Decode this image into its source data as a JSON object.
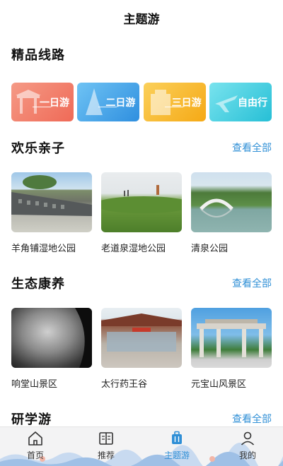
{
  "header": {
    "title": "主题游"
  },
  "featured": {
    "heading": "精品线路",
    "routes": [
      {
        "label": "一日游",
        "color": "#f27562"
      },
      {
        "label": "二日游",
        "color": "#3ea2e8"
      },
      {
        "label": "三日游",
        "color": "#f7b825"
      },
      {
        "label": "自由行",
        "color": "#3fd0e2"
      }
    ]
  },
  "family": {
    "heading": "欢乐亲子",
    "more": "查看全部",
    "items": [
      {
        "name": "羊角铺湿地公园"
      },
      {
        "name": "老道泉湿地公园"
      },
      {
        "name": "清泉公园"
      }
    ]
  },
  "wellness": {
    "heading": "生态康养",
    "more": "查看全部",
    "items": [
      {
        "name": "响堂山景区"
      },
      {
        "name": "太行药王谷"
      },
      {
        "name": "元宝山风景区"
      }
    ]
  },
  "study": {
    "heading": "研学游",
    "more": "查看全部"
  },
  "tabbar": {
    "items": [
      {
        "label": "首页",
        "icon": "home-icon"
      },
      {
        "label": "推荐",
        "icon": "book-icon"
      },
      {
        "label": "主题游",
        "icon": "suitcase-icon",
        "active": true
      },
      {
        "label": "我的",
        "icon": "user-icon"
      }
    ],
    "active_color": "#2f8fd6"
  }
}
